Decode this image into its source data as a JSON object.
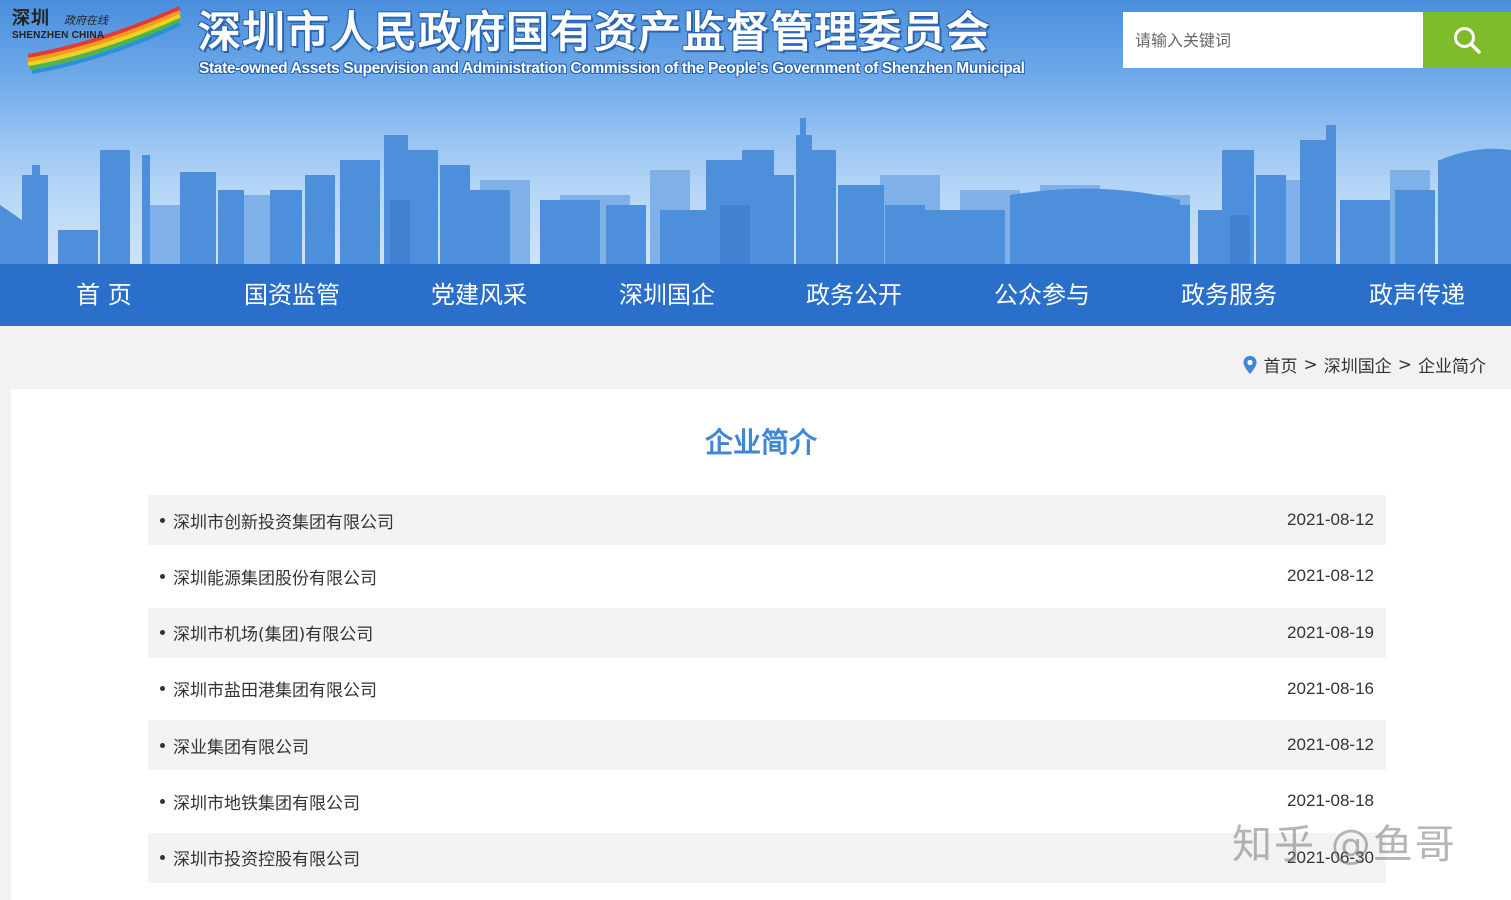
{
  "header": {
    "logo_cn": "深圳",
    "logo_cn_small": "政府在线",
    "logo_en": "SHENZHEN CHINA",
    "title": "深圳市人民政府国有资产监督管理委员会",
    "subtitle": "State-owned Assets Supervision and Administration Commission of the People's Government of Shenzhen Municipal",
    "search_placeholder": "请输入关键词"
  },
  "nav": {
    "items": [
      {
        "label": "首 页"
      },
      {
        "label": "国资监管"
      },
      {
        "label": "党建风采"
      },
      {
        "label": "深圳国企"
      },
      {
        "label": "政务公开"
      },
      {
        "label": "公众参与"
      },
      {
        "label": "政务服务"
      },
      {
        "label": "政声传递"
      }
    ]
  },
  "breadcrumb": {
    "home": "首页",
    "sep1": ">",
    "section": "深圳国企",
    "sep2": ">",
    "current": "企业简介"
  },
  "main": {
    "title": "企业简介",
    "rows": [
      {
        "name": "深圳市创新投资集团有限公司",
        "date": "2021-08-12"
      },
      {
        "name": "深圳能源集团股份有限公司",
        "date": "2021-08-12"
      },
      {
        "name": "深圳市机场(集团)有限公司",
        "date": "2021-08-19"
      },
      {
        "name": "深圳市盐田港集团有限公司",
        "date": "2021-08-16"
      },
      {
        "name": "深业集团有限公司",
        "date": "2021-08-12"
      },
      {
        "name": "深圳市地铁集团有限公司",
        "date": "2021-08-18"
      },
      {
        "name": "深圳市投资控股有限公司",
        "date": "2021-06-30"
      }
    ]
  },
  "watermark": "知乎 @鱼哥",
  "colors": {
    "nav_bg": "#2a6fc9",
    "search_button": "#7fbc2c",
    "title_blue": "#3d86d8",
    "row_shade": "#f3f3f3"
  }
}
